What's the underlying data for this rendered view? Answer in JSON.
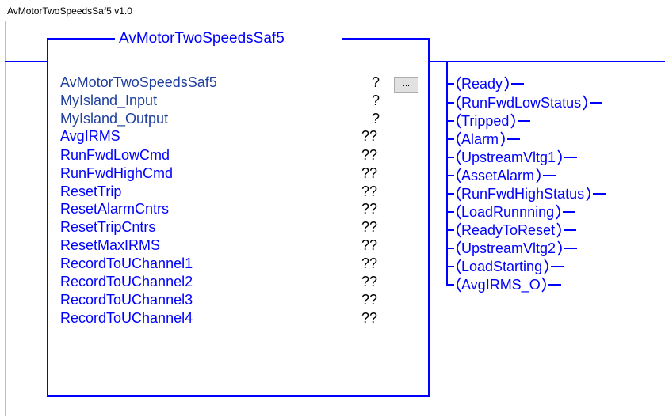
{
  "window": {
    "title": "AvMotorTwoSpeedsSaf5 v1.0"
  },
  "block": {
    "name": "AvMotorTwoSpeedsSaf5"
  },
  "colors": {
    "wire": "#0000ff",
    "input_label": "#0000ff",
    "static_label": "#1f3f9f",
    "text": "#000000"
  },
  "config_button": {
    "label": "..."
  },
  "parameters": [
    {
      "label": "AvMotorTwoSpeedsSaf5",
      "value": "?",
      "kind": "static"
    },
    {
      "label": "MyIsland_Input",
      "value": "?",
      "kind": "static"
    },
    {
      "label": "MyIsland_Output",
      "value": "?",
      "kind": "static"
    },
    {
      "label": "AvgIRMS",
      "value": "??",
      "kind": "input"
    },
    {
      "label": "RunFwdLowCmd",
      "value": "??",
      "kind": "input"
    },
    {
      "label": "RunFwdHighCmd",
      "value": "??",
      "kind": "input"
    },
    {
      "label": "ResetTrip",
      "value": "??",
      "kind": "input"
    },
    {
      "label": "ResetAlarmCntrs",
      "value": "??",
      "kind": "input"
    },
    {
      "label": "ResetTripCntrs",
      "value": "??",
      "kind": "input"
    },
    {
      "label": "ResetMaxIRMS",
      "value": "??",
      "kind": "input"
    },
    {
      "label": "RecordToUChannel1",
      "value": "??",
      "kind": "input"
    },
    {
      "label": "RecordToUChannel2",
      "value": "??",
      "kind": "input"
    },
    {
      "label": "RecordToUChannel3",
      "value": "??",
      "kind": "input"
    },
    {
      "label": "RecordToUChannel4",
      "value": "??",
      "kind": "input"
    }
  ],
  "outputs": [
    "Ready",
    "RunFwdLowStatus",
    "Tripped",
    "Alarm",
    "UpstreamVltg1",
    "AssetAlarm",
    "RunFwdHighStatus",
    "LoadRunnning",
    "ReadyToReset",
    "UpstreamVltg2",
    "LoadStarting",
    "AvgIRMS_O"
  ]
}
